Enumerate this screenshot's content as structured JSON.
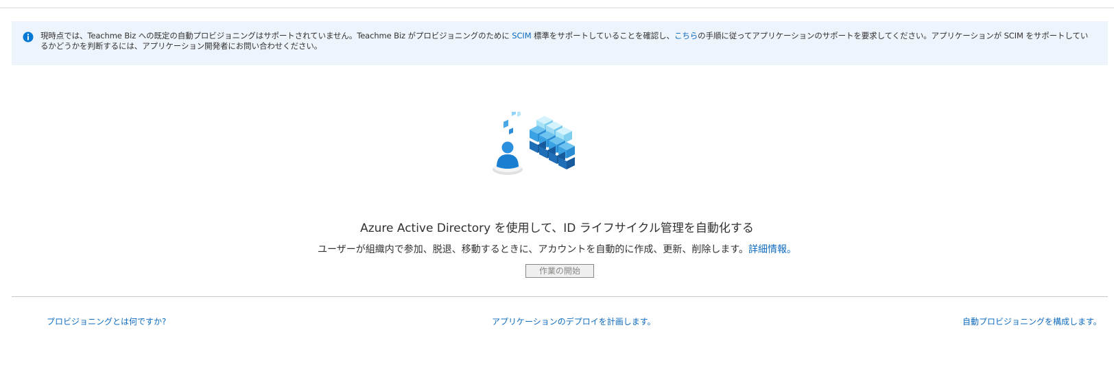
{
  "banner": {
    "icon": "info-icon",
    "text_part1": "現時点では、Teachme Biz への既定の自動プロビジョニングはサポートされていません。Teachme Biz がプロビジョニングのために ",
    "scim_link": "SCIM",
    "text_part2": " 標準をサポートしていることを確認し、",
    "here_link": "こちら",
    "text_part3": "の手順に従ってアプリケーションのサポートを要求してください。アプリケーションが SCIM をサポートしているかどうかを判断するには、アプリケーション開発者にお問い合わせください。",
    "accent_color": "#0078d4",
    "background_color": "#eef4fc"
  },
  "hero": {
    "illustration": "user-provisioning-cubes-illustration",
    "headline": "Azure Active Directory を使用して、ID ライフサイクル管理を自動化する",
    "description": "ユーザーが組織内で参加、脱退、移動するときに、アカウントを自動的に作成、更新、削除します。",
    "learn_more_link": "詳細情報。",
    "start_button": "作業の開始"
  },
  "footer": {
    "link_left": "プロビジョニングとは何ですか?",
    "link_center": "アプリケーションのデプロイを計画します。",
    "link_right": "自動プロビジョニングを構成します。",
    "link_color": "#0e6bbf"
  }
}
